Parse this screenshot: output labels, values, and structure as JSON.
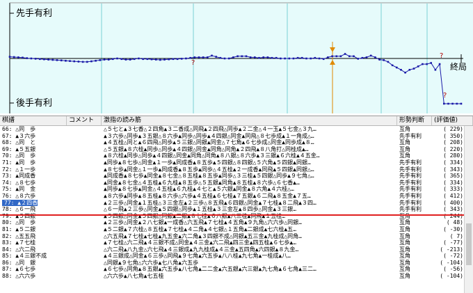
{
  "graph": {
    "upper_label": "先手有利",
    "lower_label": "後手有利",
    "end_label": "終局",
    "question_mark": "?",
    "colors": {
      "background": "#e6fbfb",
      "line": "#1a1aa8",
      "grid": "#79d0d4",
      "axis": "#000000",
      "cursor": "#e08a00",
      "question": "#b00000"
    },
    "chart_data": {
      "type": "line",
      "title": "",
      "xlabel": "",
      "ylabel": "",
      "x_range": [
        0,
        100
      ],
      "y_range": [
        -800,
        800
      ],
      "grid": true,
      "series_values": [
        30,
        25,
        20,
        15,
        5,
        0,
        -5,
        -10,
        -15,
        -20,
        -25,
        -30,
        -35,
        -40,
        -45,
        -50,
        -55,
        -60,
        -60,
        -50,
        -40,
        -30,
        -20,
        -20,
        -10,
        0,
        -10,
        -20,
        -20,
        -10,
        0,
        -10,
        -10,
        -15,
        -20,
        -25,
        -20,
        -15,
        -10,
        -10,
        -5,
        0,
        10,
        20,
        20,
        20,
        20,
        50,
        30,
        10,
        0,
        0,
        20,
        40,
        40,
        40,
        20,
        20,
        10,
        20,
        20,
        10,
        10,
        0,
        0,
        0,
        0,
        10,
        10,
        0,
        0,
        10,
        0,
        -10,
        20,
        40,
        40,
        40,
        80,
        40,
        40,
        -5,
        10,
        20,
        50,
        20,
        -20,
        -30,
        -60,
        -120,
        -160,
        -200,
        -250,
        -200,
        -180,
        -140,
        -100,
        -100,
        -80,
        -200,
        -100,
        -1200,
        -1250,
        -1250,
        -1250,
        -1250
      ]
    }
  },
  "list": {
    "headers": [
      "棋譜",
      "コメント",
      "激指の読み筋",
      "形勢判断",
      "(評価値)"
    ],
    "rows": [
      {
        "move": "66: △同　歩",
        "pv": "△５七と▲３七香△２四角▲３二香成△同飛▲２四飛△同歩▲２二金△４一玉▲５七金△３九…",
        "judge": "互角",
        "score": "(    229)"
      },
      {
        "move": "67: ▲３六歩",
        "pv": "▲３六歩△同歩▲３五銀△８六歩▲同歩△同歩▲４四銀△同金▲同飛△８七歩成▲１一角成△…",
        "judge": "先手有利",
        "score": "(    350)"
      },
      {
        "move": "68: △同　と",
        "pv": "▲４五桂△同と▲６四飛△同歩▲５三銀△同銀▲同金△７七角▲６七歩成△同金▲同歩成▲８…",
        "judge": "互角",
        "score": "(    208)"
      },
      {
        "move": "69: ▲５五銀",
        "pv": "△５五銀▲８六桂▲同歩△同歩▲４四銀△同金▲同角△同角▲２四飛▲８八角打△同桂成▲…",
        "judge": "互角",
        "score": "(    220)"
      },
      {
        "move": "70: △同　歩",
        "pv": "▲８六桂▲同歩△同歩▲４四銀△同金▲同角△同角▲８八銀△８六歩▲３三銀▲６六桂▲４五金…",
        "judge": "互角",
        "score": "(    280)"
      },
      {
        "move": "71: ▲同　歩",
        "pv": "▲同歩▲８七歩△同金▲１一歩▲同成香▲８五歩▲５四銀△８四銀△５六角▲５四銀▲同銀…",
        "judge": "先手有利",
        "score": "(    334)"
      },
      {
        "move": "72: △１一歩",
        "pv": "▲８七歩▲同金△１一歩▲同成香▲８五歩▲同歩△４五桂▲２一成香▲同飛▲５四銀▲同銀△…",
        "judge": "先手有利",
        "score": "(    343)"
      },
      {
        "move": "73: ▲同成香",
        "pv": "▲同成香▲８七歩▲同金▲８七金△８五桂▲８五歩▲同歩△３三桂▲５四銀△同歩▲９七角△…",
        "judge": "先手有利",
        "score": "(    365)"
      },
      {
        "move": "74: △８七歩",
        "pv": "▲同金▲８七金△４五桂▲６九桂▲８五歩△５五銀▲同角▲８五桂▲８六歩△６七香▲…",
        "judge": "先手有利",
        "score": "(    334)"
      },
      {
        "move": "75: ▲同　金",
        "pv": "▲同歩▲８七歩▲同金△４五桂▲６九桂▲４七と▲５六銀▲同金▲８六角▲４六桂△…",
        "judge": "先手有利",
        "score": "(    333)"
      },
      {
        "move": "76: △８六歩",
        "pv": "▲８六歩▲同歩▲８五桂▲８六歩△六歩▲４五桂▲６七桂▲７五銀▲６二飛▲８五金▲７五…",
        "judge": "先手有利",
        "score": "(    412)"
      },
      {
        "move": "77: ▲２四香",
        "pv": "▲２三歩△同金▲１五桂△３三金左▲２三歩△８五飛▲６四銀△同金▲７七桂▲８二飛▲３四…",
        "judge": "先手有利",
        "score": "(    400)"
      },
      {
        "move": "78: △６一飛",
        "pv": "△６一飛▲２三歩△同金▲５四銀△同歩▲１五桂▲３三金左▲８四歩△同金▲３三銀…",
        "judge": "先手有利",
        "score": "(    343)"
      },
      {
        "move": "79: ▲５四銀",
        "pv": "▲５四銀△同金▲５四銀△同銀▲二銀▲８七桂▲６八銀▲八三桂▲同飛▲１五桂…",
        "judge": "互角",
        "score": "(    244)"
      },
      {
        "move": "80: △同　歩",
        "pv": "▲２三歩△同金▲２八七銀▲一成香△六五飛▲７七桂▲４五角▲９九角△六六歩△同銀…",
        "judge": "互角",
        "score": "(     48)"
      },
      {
        "move": "81: ▲５二銀",
        "pv": "▲５二銀▲７六桂△８五桂▲７七桂▲４二角▲４七銀△１五角▲二銀成▲七六桂▲五…",
        "judge": "互角",
        "score": "(    -30)"
      },
      {
        "move": "82: △五五飛",
        "pv": "△六五飛▲７七桂▲七桂▲九五金▲六二角▲３四銀不成△同銀▲五三金▲九桂成△同角…",
        "judge": "互角",
        "score": "(      7)"
      },
      {
        "move": "83: ▲７七桂",
        "pv": "▲７七桂△六二飛▲４三銀不成△同金▲４三金▲六二飛▲四三金▲四五桂▲６七歩▲…",
        "judge": "互角",
        "score": "(    -77)"
      },
      {
        "move": "84: △六二飛",
        "pv": "△六二飛▲八九金△六七飛▲４三銀成▲九九桂成▲４三金▲五四角▲六四銀▲８九金…",
        "judge": "互角",
        "score": "(   -213)"
      },
      {
        "move": "85: ▲４三銀不成",
        "pv": "▲４三銀成△同金▲６三歩△同飛▲９七角▲六五歩▲八八桂▲九七角▲一桂成▲八…",
        "judge": "互角",
        "score": "(    -72)"
      },
      {
        "move": "86: △同　銀",
        "pv": "△同銀▲９七角△六六歩▲七八角▲六五歩",
        "judge": "互角",
        "score": "(   -104)"
      },
      {
        "move": "87: ▲６七歩",
        "pv": "▲６七歩△同角▲８五銀▲六五歩▲八七角▲二二金▲六五銀▲六三銀▲九七角▲６七角▲三二…",
        "judge": "互角",
        "score": "(    -56)"
      },
      {
        "move": "88: △六六歩",
        "pv": "△六六歩▲八七角▲七五桂",
        "judge": "互角",
        "score": "(   -104)"
      }
    ]
  }
}
